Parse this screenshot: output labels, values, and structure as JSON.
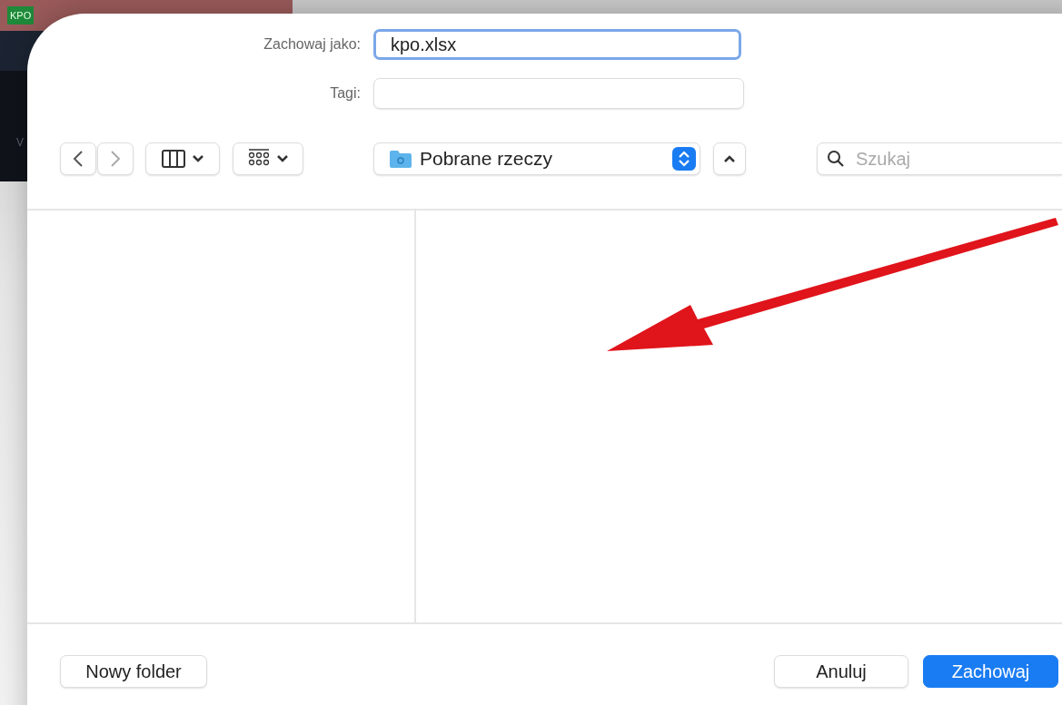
{
  "background_window": {
    "badge": "KPO",
    "side_letter": "V"
  },
  "dialog": {
    "save_as": {
      "label": "Zachowaj jako:",
      "value": "kpo.xlsx",
      "focused": true
    },
    "tags": {
      "label": "Tagi:"
    },
    "location": "Pobrane rzeczy",
    "search": {
      "placeholder": "Szukaj"
    },
    "new_folder_button": "Nowy folder",
    "footer_right": [
      {
        "label": "Anuluj",
        "kind": "normal"
      },
      {
        "label": "Zachowaj",
        "kind": "primary"
      }
    ]
  }
}
